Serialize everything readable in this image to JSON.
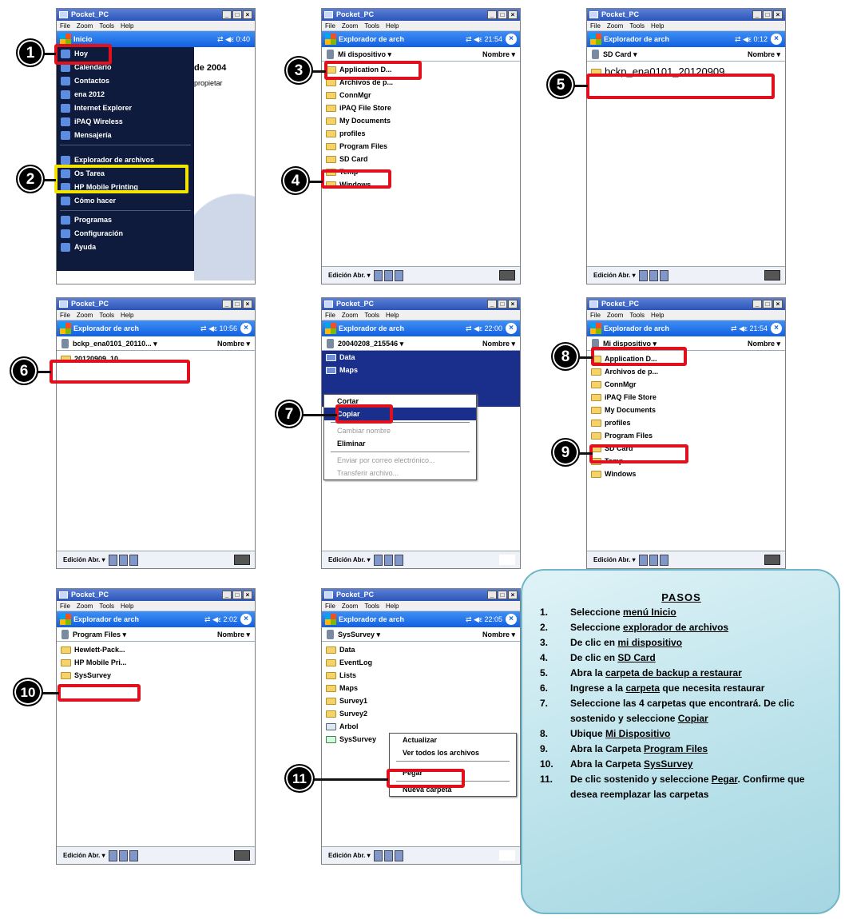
{
  "common": {
    "window_title": "Pocket_PC",
    "menu": [
      "File",
      "Zoom",
      "Tools",
      "Help"
    ],
    "win_buttons": [
      "_",
      "□",
      "×"
    ],
    "nav_app": "Explorador de arch",
    "sort_label": "Nombre ▾",
    "bottom_label": "Edición Abr. ▾"
  },
  "shot1": {
    "nav_label": "Inicio",
    "nav_status": "⇄ ◀ε 0:40",
    "behind_text": [
      "de 2004",
      "propietar"
    ],
    "start_items": [
      "Hoy",
      "Calendario",
      "Contactos",
      "ena 2012",
      "Internet Explorer",
      "iPAQ Wireless",
      "Mensajería",
      "Explorador de archivos",
      "Os Tarea",
      "HP Mobile Printing",
      "Cómo hacer",
      "Programas",
      "Configuración",
      "Ayuda"
    ]
  },
  "shot3": {
    "nav_status": "⇄ ◀ε 21:54",
    "path": "Mi dispositivo ▾",
    "files": [
      "Application D...",
      "Archivos de p...",
      "ConnMgr",
      "iPAQ File Store",
      "My Documents",
      "profiles",
      "Program Files",
      "SD Card",
      "Temp",
      "Windows"
    ]
  },
  "shot5": {
    "nav_status": "⇄ ◀ε 0:12",
    "path": "SD Card ▾",
    "file": "bckp_ena0101_20120909"
  },
  "shot6": {
    "nav_status": "⇄ ◀ε 10:56",
    "path": "bckp_ena0101_20110... ▾",
    "file": "20120909_10..."
  },
  "shot7": {
    "nav_status": "⇄ ◀ε 22:00",
    "path": "20040208_215546 ▾",
    "files": [
      "Data",
      "Maps"
    ],
    "menu": [
      "Cortar",
      "Copiar",
      "Cambiar nombre",
      "Eliminar",
      "Enviar por correo electrónico...",
      "Transferir archivo..."
    ]
  },
  "shot8": {
    "nav_status": "⇄ ◀ε 21:54",
    "path": "Mi dispositivo ▾",
    "files": [
      "Application D...",
      "Archivos de p...",
      "ConnMgr",
      "iPAQ File Store",
      "My Documents",
      "profiles",
      "Program Files",
      "SD Card",
      "Temp",
      "Windows"
    ]
  },
  "shot10": {
    "nav_status": "⇄ ◀ε 2:02",
    "path": "Program Files ▾",
    "files": [
      "Hewlett-Pack...",
      "HP Mobile Pri...",
      "SysSurvey"
    ]
  },
  "shot11": {
    "nav_status": "⇄ ◀ε 22:05",
    "path": "SysSurvey ▾",
    "files": [
      "Data",
      "EventLog",
      "Lists",
      "Maps",
      "Survey1",
      "Survey2",
      "Arbol",
      "SysSurvey"
    ],
    "menu": [
      "Actualizar",
      "Ver todos los archivos",
      "Pegar",
      "Nueva carpeta"
    ]
  },
  "markers": [
    "1",
    "2",
    "3",
    "4",
    "5",
    "6",
    "7",
    "8",
    "9",
    "10",
    "11"
  ],
  "pasos": {
    "title": "PASOS",
    "steps": [
      {
        "n": "1.",
        "a": "Seleccione ",
        "u": "menú Inicio",
        "b": ""
      },
      {
        "n": "2.",
        "a": "Seleccione ",
        "u": "explorador de archivos",
        "b": ""
      },
      {
        "n": "3.",
        "a": "De clic en ",
        "u": "mi dispositivo",
        "b": ""
      },
      {
        "n": "4.",
        "a": "De clic en ",
        "u": "SD Card",
        "b": ""
      },
      {
        "n": "5.",
        "a": "Abra la ",
        "u": "carpeta de backup a restaurar",
        "b": ""
      },
      {
        "n": "6.",
        "a": "Ingrese a la ",
        "u": "carpeta",
        "b": " que necesita restaurar"
      },
      {
        "n": "7.",
        "a": "Seleccione las 4 carpetas que encontrará. De clic sostenido y seleccione ",
        "u": "Copiar",
        "b": ""
      },
      {
        "n": "8.",
        "a": "Ubique ",
        "u": "Mi Dispositivo",
        "b": ""
      },
      {
        "n": "9.",
        "a": "Abra la Carpeta ",
        "u": "Program Files",
        "b": ""
      },
      {
        "n": "10.",
        "a": "Abra la Carpeta ",
        "u": "SysSurvey",
        "b": ""
      },
      {
        "n": "11.",
        "a": "De clic sostenido y seleccione ",
        "u": "Pegar",
        "b": ". Confirme que desea reemplazar las carpetas"
      }
    ]
  }
}
